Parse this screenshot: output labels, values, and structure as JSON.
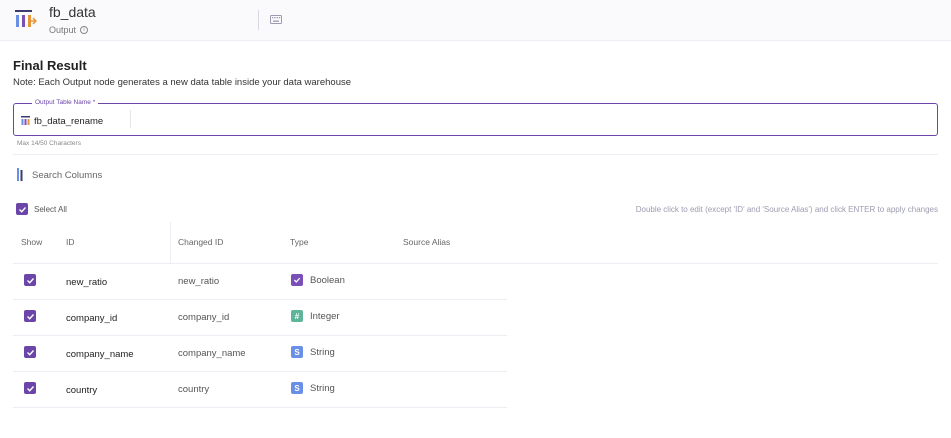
{
  "header": {
    "title": "fb_data",
    "subtitle": "Output",
    "icon": "output-node-icon"
  },
  "section": {
    "title": "Final Result",
    "note": "Note: Each Output node generates a new data table inside your data warehouse"
  },
  "output_field": {
    "label": "Output Table Name *",
    "value": "fb_data_rename",
    "helper": "Max 14/50 Characters"
  },
  "search": {
    "placeholder": "Search Columns"
  },
  "select_all": {
    "label": "Select All",
    "checked": true
  },
  "hint": "Double click to edit (except 'ID' and 'Source Alias') and click ENTER to apply changes",
  "table": {
    "headers": {
      "show": "Show",
      "id": "ID",
      "changed_id": "Changed ID",
      "type": "Type",
      "source_alias": "Source Alias"
    },
    "rows": [
      {
        "show": true,
        "id": "new_ratio",
        "changed_id": "new_ratio",
        "type": "Boolean",
        "source_alias": ""
      },
      {
        "show": true,
        "id": "company_id",
        "changed_id": "company_id",
        "type": "Integer",
        "source_alias": ""
      },
      {
        "show": true,
        "id": "company_name",
        "changed_id": "company_name",
        "type": "String",
        "source_alias": ""
      },
      {
        "show": true,
        "id": "country",
        "changed_id": "country",
        "type": "String",
        "source_alias": ""
      }
    ]
  },
  "colors": {
    "accent": "#6b46a8",
    "boolean_badge": "#7b4fb8",
    "integer_badge": "#5fb59a",
    "string_badge": "#6a8fe6"
  }
}
